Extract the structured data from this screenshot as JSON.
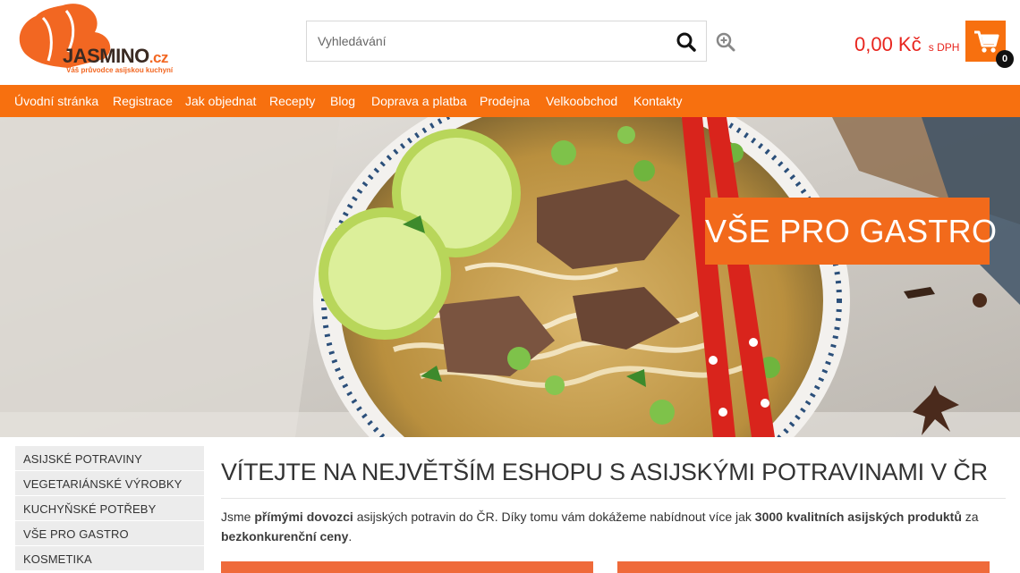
{
  "logo": {
    "name": "JASMINO",
    "suffix": ".cz",
    "tagline": "Váš průvodce asijskou kuchyní"
  },
  "search": {
    "placeholder": "Vyhledávání"
  },
  "cart": {
    "price": "0,00 Kč",
    "vat": "s DPH",
    "count": "0"
  },
  "nav": {
    "items": [
      {
        "label": "Úvodní stránka"
      },
      {
        "label": "Registrace"
      },
      {
        "label": "Jak objednat"
      },
      {
        "label": "Recepty"
      },
      {
        "label": "Blog"
      },
      {
        "label": "Doprava a platba"
      },
      {
        "label": "Prodejna"
      },
      {
        "label": "Velkoobchod"
      },
      {
        "label": "Kontakty"
      }
    ]
  },
  "hero": {
    "badge": "VŠE PRO GASTRO"
  },
  "sidebar": {
    "items": [
      {
        "label": "ASIJSKÉ POTRAVINY"
      },
      {
        "label": "VEGETARIÁNSKÉ VÝROBKY"
      },
      {
        "label": "KUCHYŇSKÉ POTŘEBY"
      },
      {
        "label": "VŠE PRO GASTRO"
      },
      {
        "label": "KOSMETIKA"
      }
    ]
  },
  "main": {
    "title": "VÍTEJTE NA NEJVĚTŠÍM ESHOPU S ASIJSKÝMI POTRAVINAMI V ČR",
    "intro": {
      "p1": "Jsme ",
      "b1": "přímými dovozci",
      "p2": " asijských potravin do ČR. Díky tomu vám dokážeme nabídnout více jak ",
      "b2": "3000 kvalitních asijských produktů",
      "p3": " za ",
      "b3": "bezkonkurenční ceny",
      "p4": "."
    }
  },
  "colors": {
    "accent": "#f7700f",
    "price": "#e8251e",
    "sidebar_bg": "#ececec"
  },
  "icons": {
    "search": "search-icon",
    "zoom": "zoom-in-icon",
    "cart": "shopping-cart-icon"
  }
}
